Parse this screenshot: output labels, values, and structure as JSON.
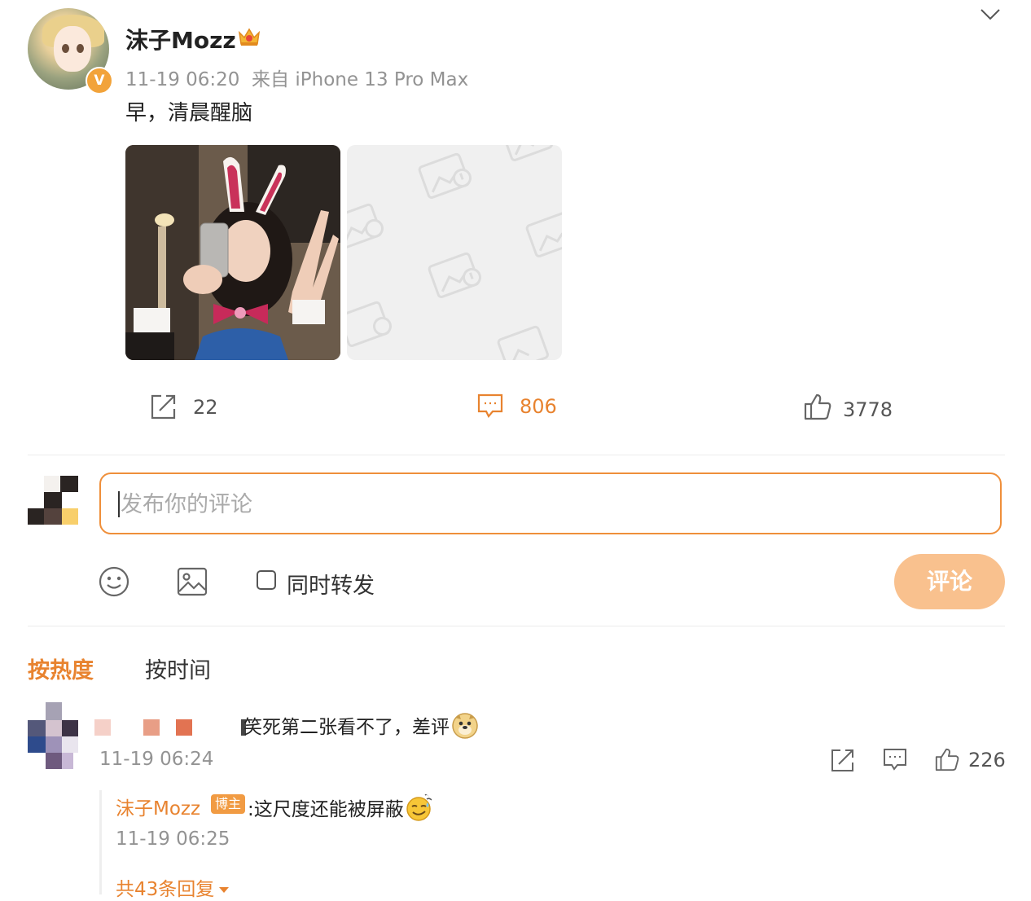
{
  "post": {
    "author": "沫子Mozz",
    "verified_badge": "V",
    "meta": "11-19 06:20  来自 iPhone 13 Pro Max",
    "text": "早，清晨醒脑",
    "images": [
      "photo",
      "blocked-image-placeholder"
    ]
  },
  "actions": {
    "repost_count": "22",
    "comment_count": "806",
    "like_count": "3778"
  },
  "composer": {
    "placeholder": "发布你的评论",
    "value": "",
    "repost_label": "同时转发",
    "submit_label": "评论"
  },
  "sort_tabs": {
    "hot": "按热度",
    "time": "按时间"
  },
  "comments": [
    {
      "text": "笑死第二张看不了，差评",
      "time": "11-19 06:24",
      "like_count": "226",
      "reply": {
        "author": "沫子Mozz",
        "author_badge": "博主",
        "text": ":这尺度还能被屏蔽",
        "time": "11-19 06:25",
        "more_label": "共43条回复"
      }
    }
  ],
  "colors": {
    "accent": "#e8832f",
    "submit_disabled": "#f9c18e",
    "meta_text": "#939393"
  }
}
